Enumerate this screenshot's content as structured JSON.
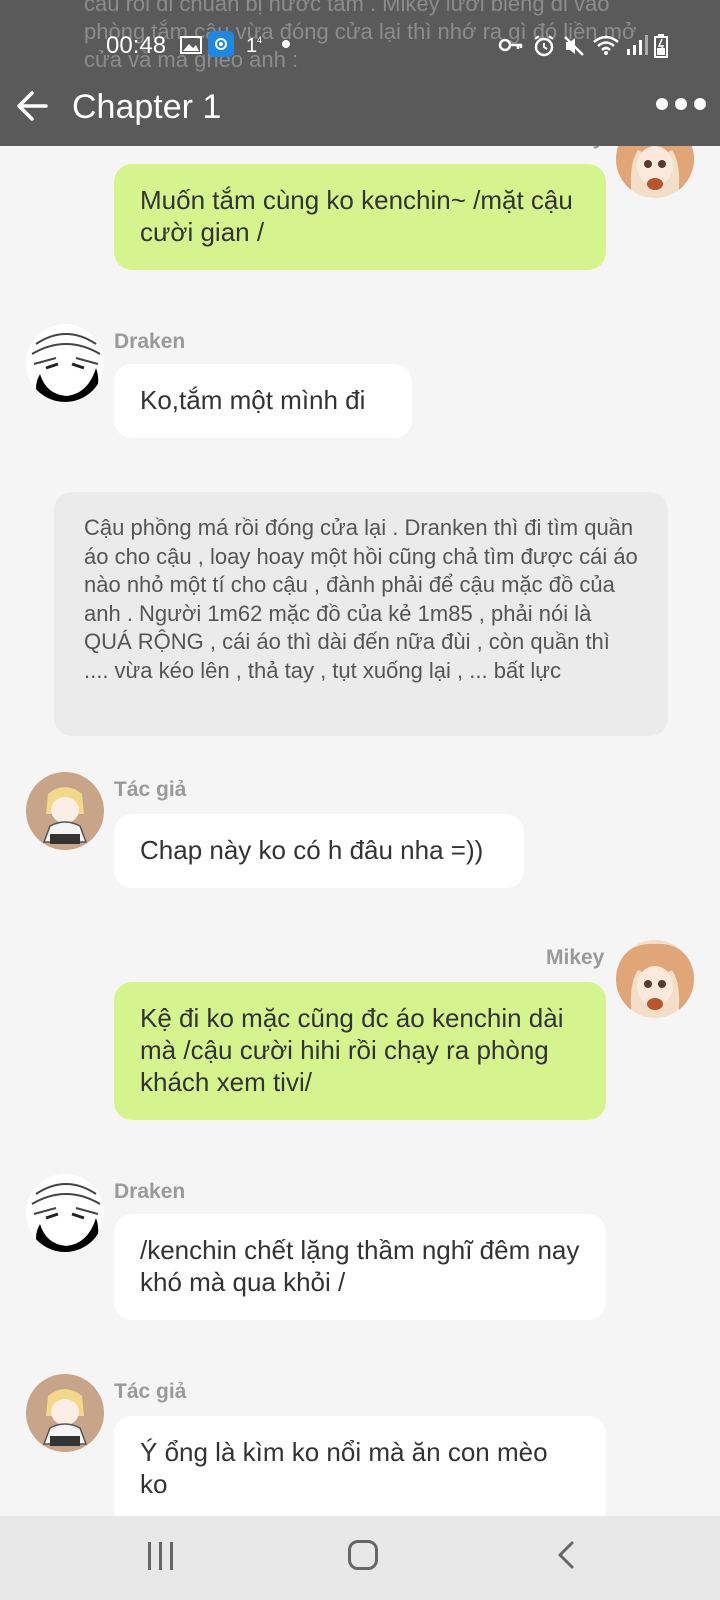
{
  "background_text": "câu rồi đi chuẩn bị nước tắm . Mikey lười biếng đi vào phòng tắm cậu vừa đóng cửa lại thì nhớ ra gì đó liền mở cửa và mà gheo anh :",
  "status_bar": {
    "time": "00:48",
    "icons": [
      "gallery-icon",
      "app-notification-icon",
      "sim-1-icon",
      "dot-icon",
      "key-icon",
      "alarm-icon",
      "mute-icon",
      "wifi-icon",
      "signal-icon",
      "battery-icon"
    ]
  },
  "app_bar": {
    "title": "Chapter 1",
    "back_icon": "arrow-left-icon",
    "more_icon": "more-horizontal-icon"
  },
  "messages": [
    {
      "sender": "Mikey",
      "side": "right",
      "text": "Muốn tắm cùng ko kenchin~ /mặt cậu cười gian /"
    },
    {
      "sender": "Draken",
      "side": "left",
      "text": "Ko,tắm một mình đi"
    },
    {
      "sender": "Tác giả",
      "side": "left",
      "text": "Chap này ko có h đâu nha =))"
    },
    {
      "sender": "Mikey",
      "side": "right",
      "text": "Kệ đi ko mặc cũng đc áo kenchin dài mà /cậu cười hihi rồi chạy ra phòng khách xem tivi/"
    },
    {
      "sender": "Draken",
      "side": "left",
      "text": "/kenchin chết lặng thầm nghĩ đêm nay khó mà qua khỏi /"
    },
    {
      "sender": "Tác giả",
      "side": "left",
      "text": "Ý ổng là kìm ko nổi mà ăn con mèo ko"
    }
  ],
  "narration": "Cậu phồng má rồi đóng cửa lại . Dranken thì đi tìm quần áo cho cậu , loay hoay một hồi cũng chả tìm được cái áo nào nhỏ một tí cho cậu , đành phải để cậu mặc đồ của anh . Người 1m62 mặc đồ của kẻ 1m85 , phải nói là QUÁ RỘNG , cái áo thì dài đến nữa đùi , còn quần thì .... vừa kéo lên , thả tay , tụt xuống lại , ... bất lực",
  "colors": {
    "mikey_bubble": "#d6f48e",
    "other_bubble": "#ffffff",
    "narration_bg": "#ebebeb",
    "header_bg": "#5a5a5a"
  }
}
